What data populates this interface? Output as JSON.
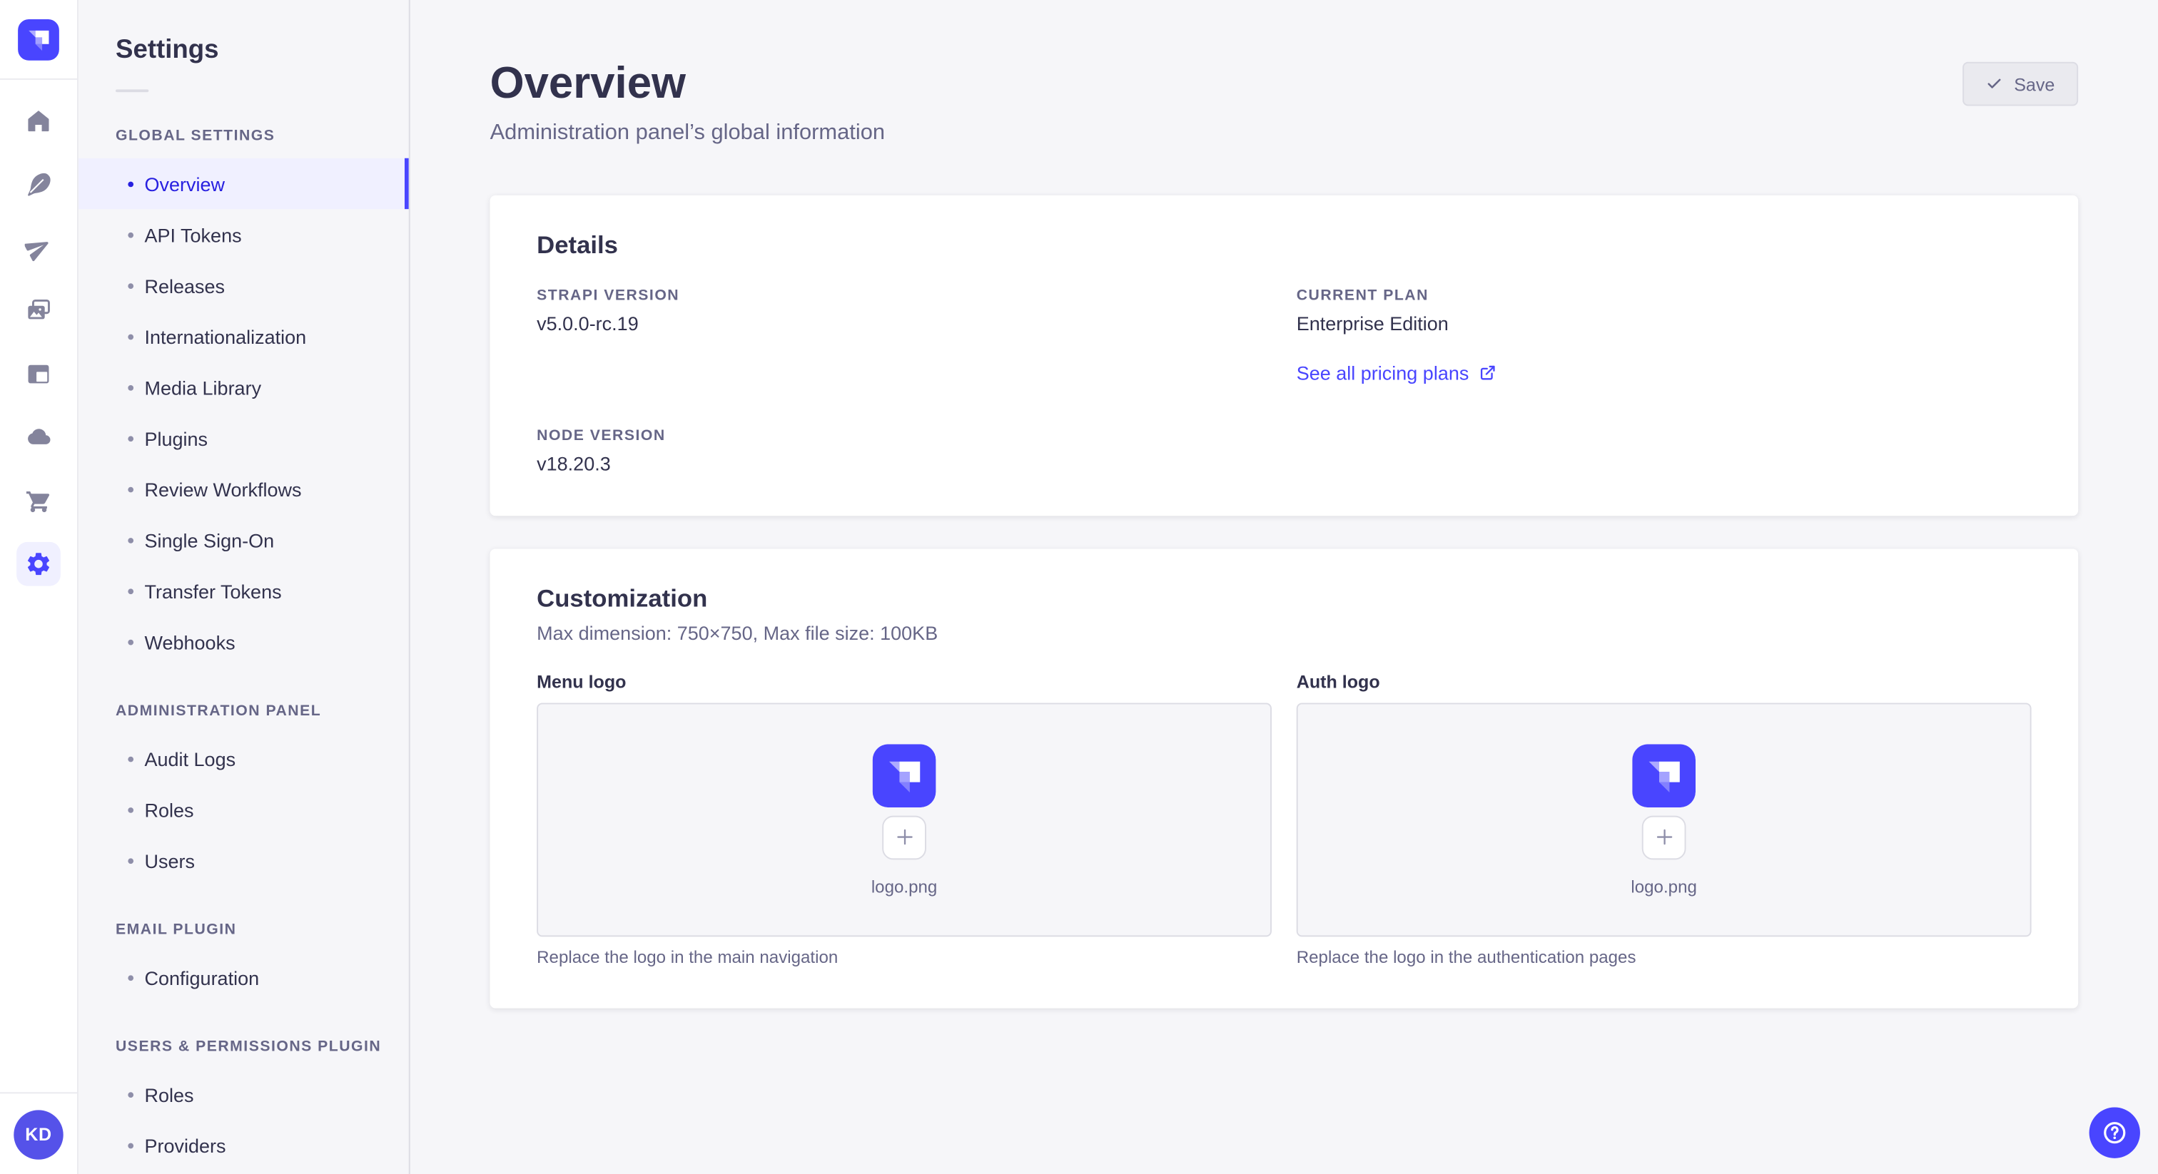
{
  "colors": {
    "primary": "#4945ff",
    "primary_text_active": "#271fe0",
    "active_bg": "#f0f0ff",
    "text": "#32324d",
    "text_muted": "#666687",
    "page_bg": "#f6f6f9",
    "border": "#dcdce4"
  },
  "rail": {
    "logo_icon": "strapi-logo",
    "icons": [
      "home",
      "content-manager-feather",
      "send-plane",
      "media-library-images",
      "content-type-builder-layout",
      "deploy-cloud",
      "marketplace-cart",
      "settings-gear"
    ],
    "avatar_initials": "KD"
  },
  "settings_nav": {
    "title": "Settings",
    "sections": [
      {
        "label": "GLOBAL SETTINGS",
        "items": [
          {
            "label": "Overview",
            "active": true
          },
          {
            "label": "API Tokens"
          },
          {
            "label": "Releases"
          },
          {
            "label": "Internationalization"
          },
          {
            "label": "Media Library"
          },
          {
            "label": "Plugins"
          },
          {
            "label": "Review Workflows"
          },
          {
            "label": "Single Sign-On"
          },
          {
            "label": "Transfer Tokens"
          },
          {
            "label": "Webhooks"
          }
        ]
      },
      {
        "label": "ADMINISTRATION PANEL",
        "items": [
          {
            "label": "Audit Logs"
          },
          {
            "label": "Roles"
          },
          {
            "label": "Users"
          }
        ]
      },
      {
        "label": "EMAIL PLUGIN",
        "items": [
          {
            "label": "Configuration"
          }
        ]
      },
      {
        "label": "USERS & PERMISSIONS PLUGIN",
        "items": [
          {
            "label": "Roles"
          },
          {
            "label": "Providers"
          }
        ]
      }
    ]
  },
  "header": {
    "title": "Overview",
    "subtitle": "Administration panel’s global information",
    "save_label": "Save"
  },
  "details_card": {
    "heading": "Details",
    "strapi_version": {
      "label": "STRAPI VERSION",
      "value": "v5.0.0-rc.19"
    },
    "current_plan": {
      "label": "CURRENT PLAN",
      "value": "Enterprise Edition",
      "link_label": "See all pricing plans"
    },
    "node_version": {
      "label": "NODE VERSION",
      "value": "v18.20.3"
    }
  },
  "customization_card": {
    "heading": "Customization",
    "constraints": "Max dimension: 750×750, Max file size: 100KB",
    "menu_logo": {
      "label": "Menu logo",
      "filename": "logo.png",
      "hint": "Replace the logo in the main navigation"
    },
    "auth_logo": {
      "label": "Auth logo",
      "filename": "logo.png",
      "hint": "Replace the logo in the authentication pages"
    }
  }
}
